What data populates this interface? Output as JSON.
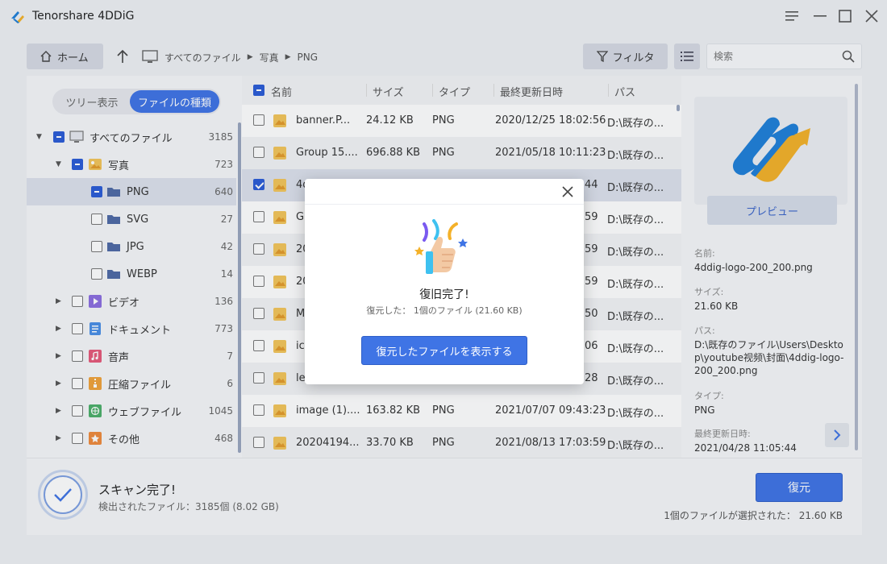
{
  "app": {
    "title": "Tenorshare 4DDiG"
  },
  "window": {
    "menu_icon": "menu-icon",
    "minimize_icon": "minimize-icon",
    "maximize_icon": "maximize-icon",
    "close_icon": "close-icon"
  },
  "toolbar": {
    "home_label": "ホーム",
    "breadcrumb": [
      "すべてのファイル",
      "写真",
      "PNG"
    ],
    "filter_label": "フィルタ",
    "search_placeholder": "検索"
  },
  "view_toggle": {
    "tree": "ツリー表示",
    "type": "ファイルの種類"
  },
  "tree": [
    {
      "label": "すべてのファイル",
      "count": "3185"
    },
    {
      "label": "写真",
      "count": "723"
    },
    {
      "label": "PNG",
      "count": "640"
    },
    {
      "label": "SVG",
      "count": "27"
    },
    {
      "label": "JPG",
      "count": "42"
    },
    {
      "label": "WEBP",
      "count": "14"
    },
    {
      "label": "ビデオ",
      "count": "136"
    },
    {
      "label": "ドキュメント",
      "count": "773"
    },
    {
      "label": "音声",
      "count": "7"
    },
    {
      "label": "圧縮ファイル",
      "count": "6"
    },
    {
      "label": "ウェブファイル",
      "count": "1045"
    },
    {
      "label": "その他",
      "count": "468"
    }
  ],
  "table": {
    "headers": {
      "name": "名前",
      "size": "サイズ",
      "type": "タイプ",
      "modified": "最終更新日時",
      "path": "パス"
    },
    "rows": [
      {
        "name": "banner.P...",
        "size": "24.12 KB",
        "type": "PNG",
        "modified": "2020/12/25 18:02:56",
        "path": "D:\\既存の..."
      },
      {
        "name": "Group 15....",
        "size": "696.88 KB",
        "type": "PNG",
        "modified": "2021/05/18 10:11:23",
        "path": "D:\\既存の..."
      },
      {
        "name": "4d",
        "size": "",
        "type": "",
        "modified": "44",
        "path": "D:\\既存の..."
      },
      {
        "name": "G",
        "size": "",
        "type": "",
        "modified": "59",
        "path": "D:\\既存の..."
      },
      {
        "name": "20",
        "size": "",
        "type": "",
        "modified": "59",
        "path": "D:\\既存の..."
      },
      {
        "name": "20",
        "size": "",
        "type": "",
        "modified": "59",
        "path": "D:\\既存の..."
      },
      {
        "name": "M",
        "size": "",
        "type": "",
        "modified": "50",
        "path": "D:\\既存の..."
      },
      {
        "name": "ic",
        "size": "",
        "type": "",
        "modified": "06",
        "path": "D:\\既存の..."
      },
      {
        "name": "le",
        "size": "",
        "type": "",
        "modified": "28",
        "path": "D:\\既存の..."
      },
      {
        "name": "image (1)....",
        "size": "163.82 KB",
        "type": "PNG",
        "modified": "2021/07/07 09:43:23",
        "path": "D:\\既存の..."
      },
      {
        "name": "20204194...",
        "size": "33.70 KB",
        "type": "PNG",
        "modified": "2021/08/13 17:03:59",
        "path": "D:\\既存の..."
      }
    ]
  },
  "preview": {
    "button": "プレビュー",
    "name_label": "名前:",
    "name": "4ddig-logo-200_200.png",
    "size_label": "サイズ:",
    "size": "21.60 KB",
    "path_label": "パス:",
    "path": "D:\\既存のファイル\\Users\\Desktop\\youtube视频\\封面\\4ddig-logo-200_200.png",
    "type_label": "タイプ:",
    "type": "PNG",
    "modified_label": "最終更新日時:",
    "modified": "2021/04/28 11:05:44"
  },
  "status": {
    "title": "スキャン完了!",
    "detail": "検出されたファイル：3185個 (8.02 GB)",
    "recover_button": "復元",
    "selection": "1個のファイルが選択された：  21.60 KB"
  },
  "modal": {
    "title": "復旧完了!",
    "subtitle": "復元した：  1個のファイル (21.60 KB)",
    "button": "復元したファイルを表示する"
  },
  "colors": {
    "accent": "#3f74e5",
    "selected_row": "#dde1ec",
    "logo_blue": "#1f7fd8",
    "logo_orange": "#f4b129"
  }
}
